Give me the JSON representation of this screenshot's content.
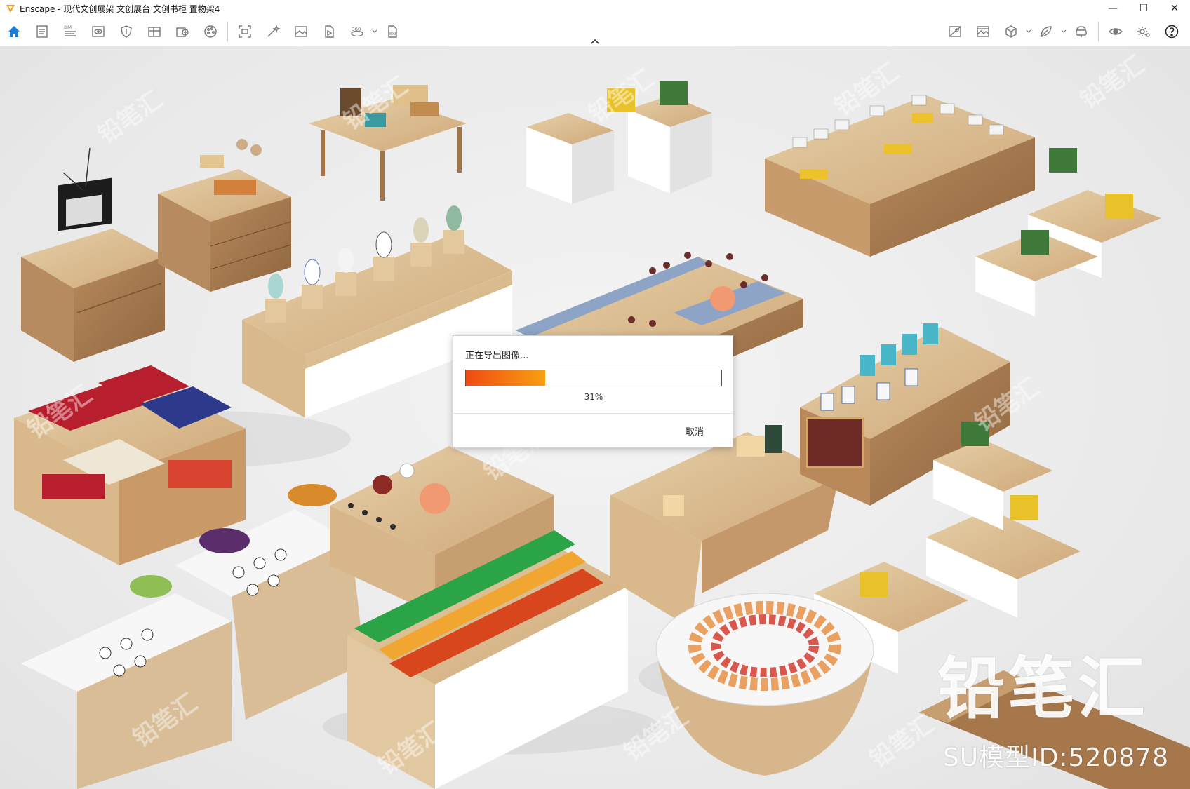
{
  "window": {
    "title": "Enscape - 现代文创展架 文创展台 文创书柜 置物架4",
    "minimize_glyph": "—",
    "maximize_glyph": "☐",
    "close_glyph": "✕"
  },
  "toolbar": {
    "left_icons": [
      "home-icon",
      "document-icon",
      "bim-icon",
      "view-icon",
      "shield-icon",
      "material-editor-icon",
      "asset-library-icon",
      "palette-icon",
      "screenshot-icon",
      "magic-icon",
      "image-icon",
      "video-icon",
      "panorama-360-icon",
      "exe-export-icon"
    ],
    "right_icons": [
      "view-management-icon",
      "batch-render-icon",
      "box-icon",
      "leaf-icon",
      "vr-headset-icon",
      "visibility-icon",
      "settings-icon",
      "help-icon"
    ],
    "collapse_glyph": "⌃"
  },
  "viewport": {
    "brand_watermark": "铅笔汇",
    "model_id": "SU模型ID:520878"
  },
  "dialog": {
    "title": "正在导出图像...",
    "progress_percent": 31,
    "progress_label": "31%",
    "cancel_label": "取消"
  },
  "colors": {
    "progress_start": "#f04a12",
    "progress_end": "#f8a012",
    "accent_blue": "#1a7fd6",
    "logo_orange": "#f29a1d"
  }
}
